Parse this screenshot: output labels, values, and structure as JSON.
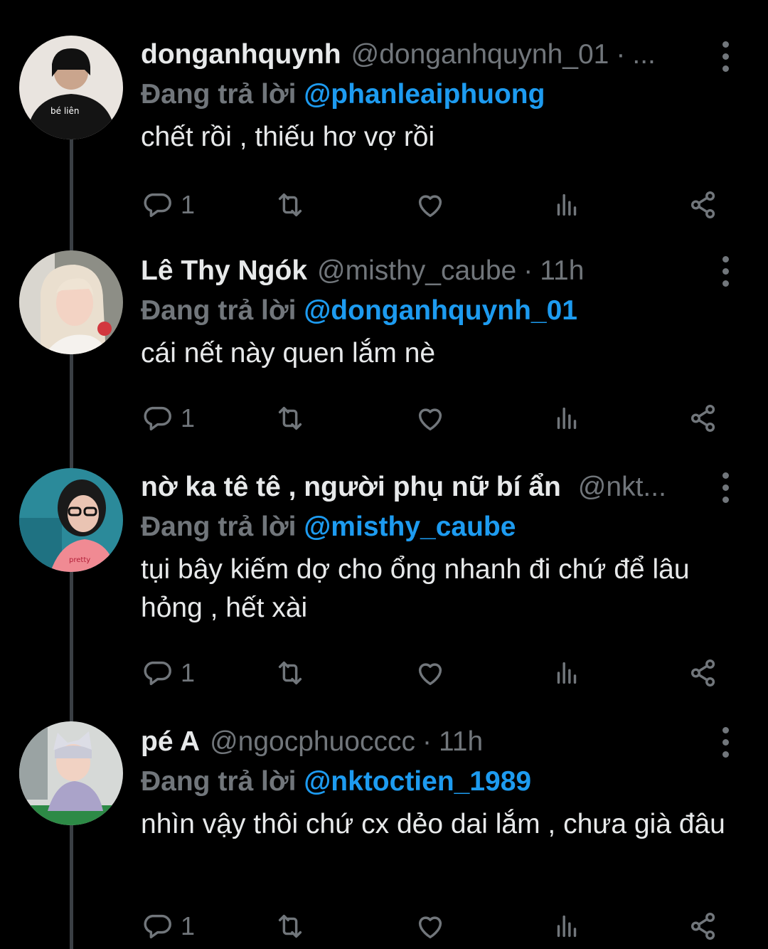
{
  "tweets": [
    {
      "display_name": "donganhquynh",
      "handle": "@donganhquynh_01",
      "separator": "·",
      "time": "...",
      "reply_prefix": "Đang trả lời",
      "reply_to": "@phanleaiphuong",
      "text": "chết rồi , thiếu hơ vợ rồi",
      "reply_count": "1",
      "avatar_shirt_text": "bé liên"
    },
    {
      "display_name": "Lê Thy Ngók",
      "handle": "@misthy_caube",
      "separator": "·",
      "time": "11h",
      "reply_prefix": "Đang trả lời",
      "reply_to": "@donganhquynh_01",
      "text": "cái nết này quen lắm nè",
      "reply_count": "1"
    },
    {
      "display_name": "nờ ka tê tê , người phụ nữ bí ẩn",
      "handle": "@nkt...",
      "separator": "",
      "time": "",
      "reply_prefix": "Đang trả lời",
      "reply_to": "@misthy_caube",
      "text": "tụi bây kiếm dợ cho ổng nhanh đi chứ để lâu hỏng , hết xài",
      "reply_count": "1"
    },
    {
      "display_name": "pé A",
      "handle": "@ngocphuocccc",
      "separator": "·",
      "time": "11h",
      "reply_prefix": "Đang trả lời",
      "reply_to": "@nktoctien_1989",
      "text": "nhìn vậy thôi chứ cx dẻo dai lắm , chưa già đâu",
      "reply_count": "1"
    }
  ],
  "icons": {
    "reply": "reply-icon",
    "retweet": "retweet-icon",
    "like": "heart-icon",
    "views": "analytics-icon",
    "share": "share-icon",
    "more": "more-vertical-icon"
  },
  "colors": {
    "background": "#000000",
    "text": "#e7e9ea",
    "muted": "#71767b",
    "mention": "#1d9bf0",
    "thread_line": "#3a3f44"
  }
}
